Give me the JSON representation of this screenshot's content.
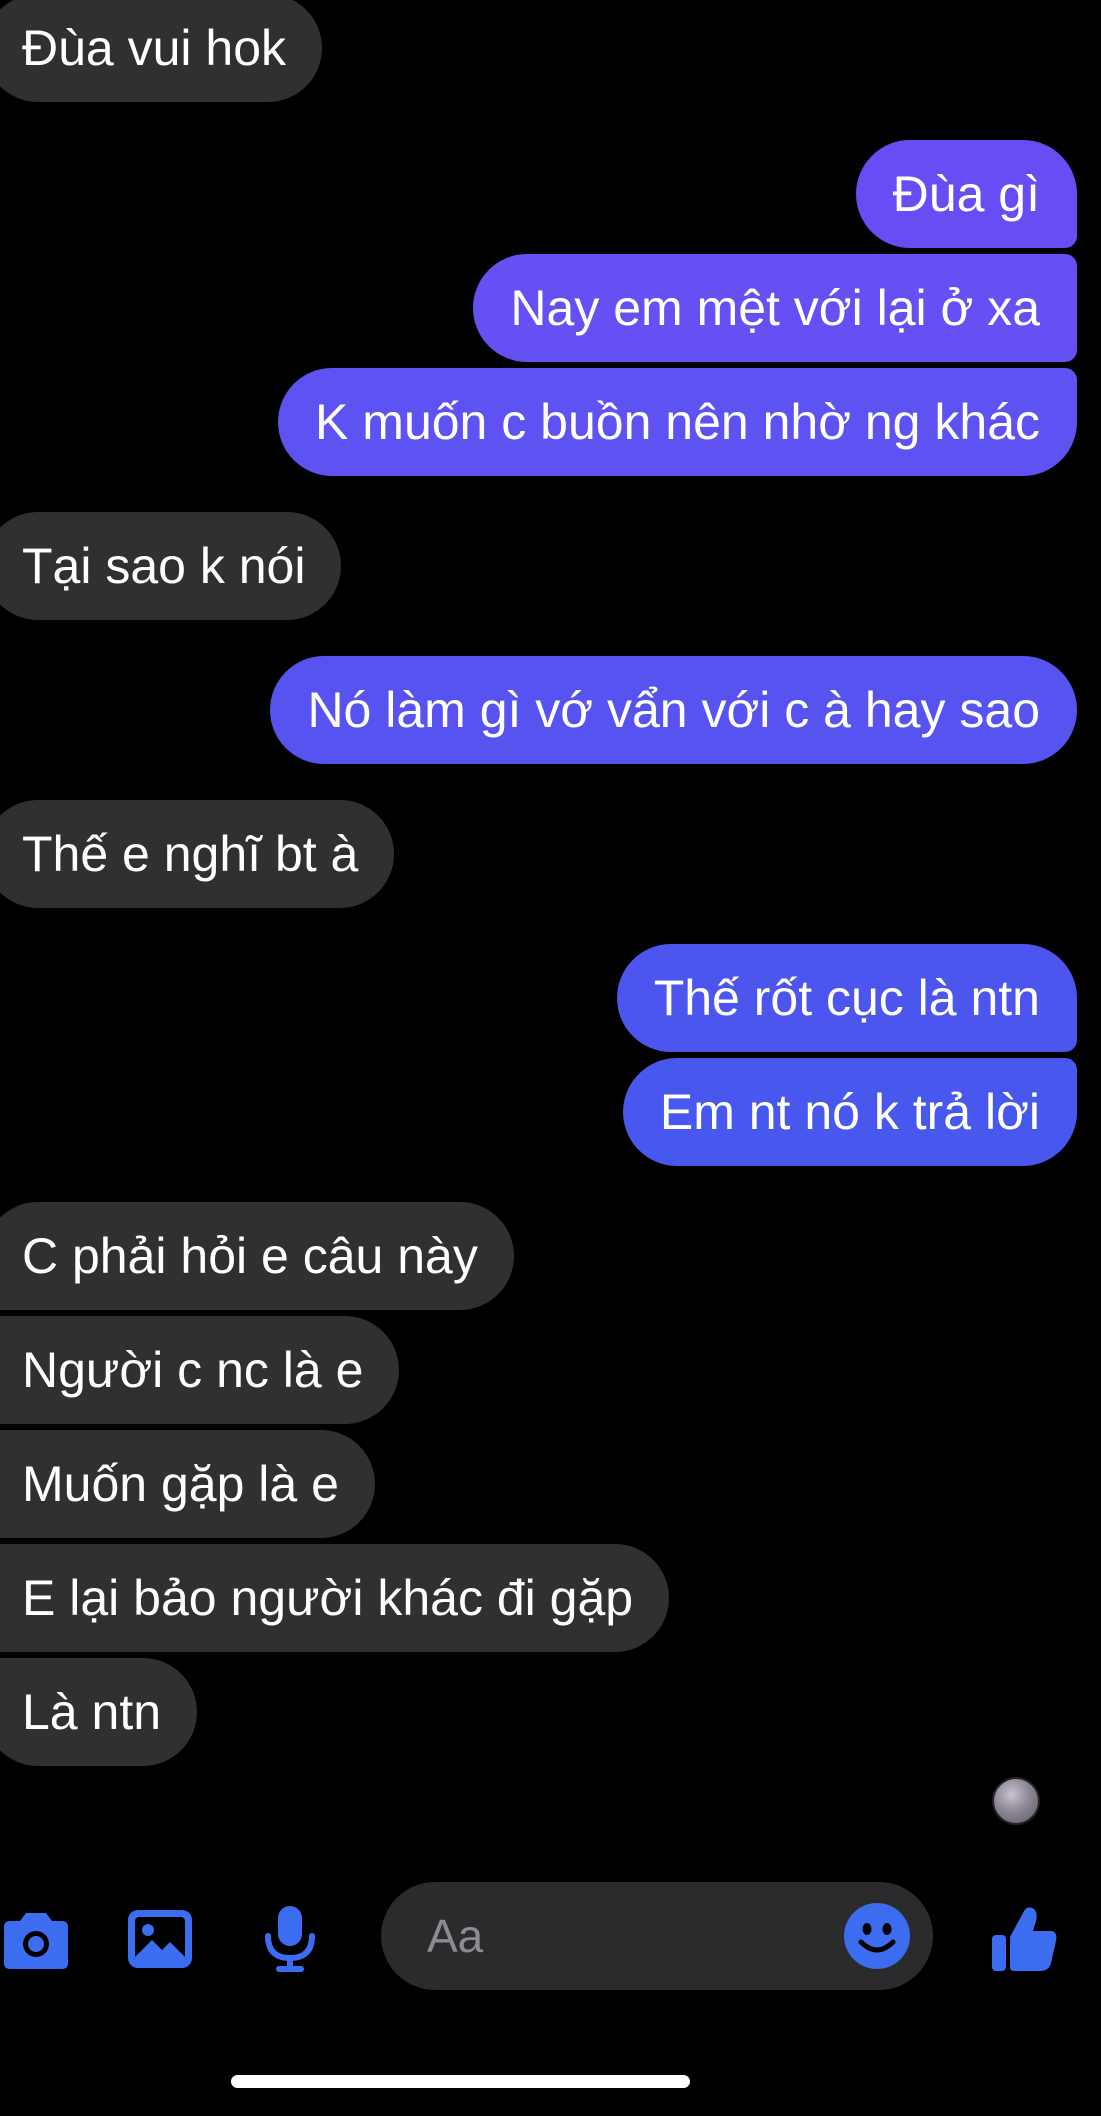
{
  "messages": [
    {
      "dir": "in",
      "text": "Đùa vui hok"
    },
    {
      "dir": "out",
      "text": "Đùa gì"
    },
    {
      "dir": "out",
      "text": "Nay em mệt với lại ở xa"
    },
    {
      "dir": "out",
      "text": "K muốn c buồn nên nhờ ng khác"
    },
    {
      "dir": "in",
      "text": "Tại sao k nói"
    },
    {
      "dir": "out",
      "text": "Nó làm gì vớ vẩn với c à hay sao"
    },
    {
      "dir": "in",
      "text": "Thế e nghĩ bt à"
    },
    {
      "dir": "out",
      "text": "Thế rốt cục là ntn"
    },
    {
      "dir": "out",
      "text": "Em nt nó k trả lời"
    },
    {
      "dir": "in",
      "text": "C phải hỏi e câu này"
    },
    {
      "dir": "in",
      "text": "Người c nc là e"
    },
    {
      "dir": "in",
      "text": "Muốn gặp là e"
    },
    {
      "dir": "in",
      "text": "E lại bảo người khác đi gặp"
    },
    {
      "dir": "in",
      "text": "Là ntn"
    }
  ],
  "composer": {
    "placeholder": "Aa",
    "icons": [
      "camera-icon",
      "photo-icon",
      "microphone-icon",
      "emoji-icon",
      "thumbs-up-icon"
    ]
  },
  "colors": {
    "background": "#000000",
    "incoming_bubble": "#303030",
    "outgoing_gradient_top": "#6a4cf4",
    "outgoing_gradient_bottom": "#4457ee",
    "accent_icon": "#3c6df0"
  }
}
